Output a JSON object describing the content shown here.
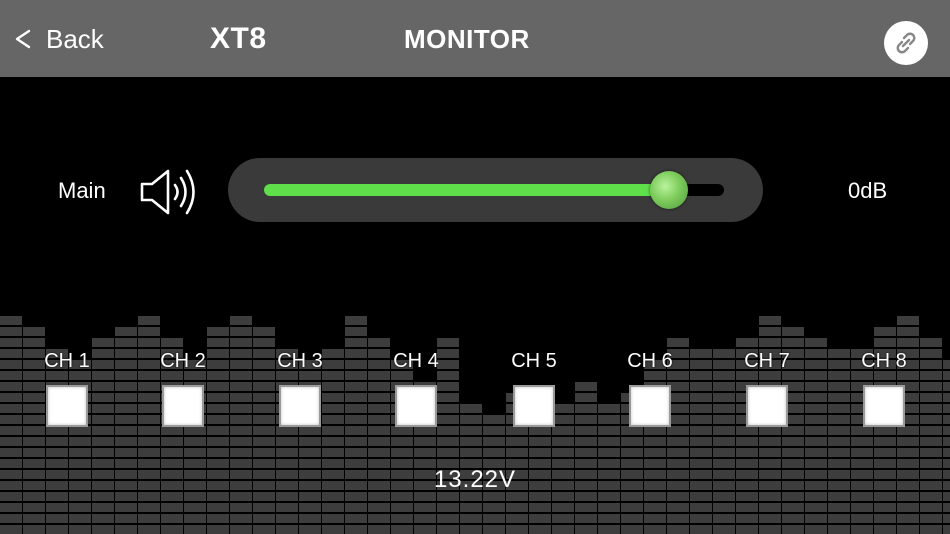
{
  "header": {
    "back_label": "Back",
    "device": "XT8",
    "page_title": "MONITOR"
  },
  "main": {
    "label": "Main",
    "level_fraction": 0.88,
    "db_value": "0dB"
  },
  "channels": [
    "CH 1",
    "CH 2",
    "CH 3",
    "CH 4",
    "CH 5",
    "CH 6",
    "CH 7",
    "CH 8"
  ],
  "status": {
    "voltage": "13.22V"
  },
  "colors": {
    "header_bg": "#666666",
    "slider_fill": "#5fe04a",
    "meter_segment": "#3d3d3d"
  },
  "icons": {
    "back": "chevron-left-icon",
    "link": "link-icon",
    "speaker": "speaker-icon"
  }
}
